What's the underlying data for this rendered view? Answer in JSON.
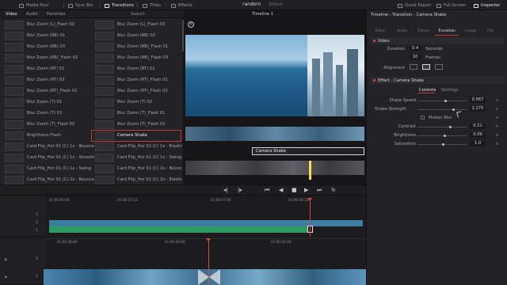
{
  "toolbar": {
    "media_pool": "Media Pool",
    "sync_bin": "Sync Bin",
    "transitions": "Transitions",
    "titles": "Titles",
    "effects": "Effects",
    "project_title": "random",
    "project_status": "Edited",
    "quick_export": "Quick Export",
    "full_screen": "Full Screen",
    "inspector": "Inspector"
  },
  "library": {
    "tabs": [
      "Video",
      "Audio",
      "Favorites"
    ],
    "search": "Search",
    "left_items": [
      "Blur Zoom (L)_Flash 02",
      "Blur Zoom (RB) 01",
      "Blur Zoom (RB) 03",
      "Blur Zoom (RB)_Flash 02",
      "Blur Zoom (RT) 01",
      "Blur Zoom (RT) 03",
      "Blur Zoom (RT)_Flash 02",
      "Blur Zoom (T) 01",
      "Blur Zoom (T) 03",
      "Blur Zoom (T)_Flash 02",
      "Brightness Flash",
      "Card Flip_Hor 01 (C) 1x - Bounce",
      "Card Flip_Hor 01 (C) 1x - Smooth",
      "Card Flip_Hor 01 (C) 1x - Swing",
      "Card Flip_Hor 01 (C) 2x - Bounce"
    ],
    "right_items": [
      "Blur Zoom (L)_Flash 03",
      "Blur Zoom (RB) 02",
      "Blur Zoom (RB)_Flash 01",
      "Blur Zoom (RB)_Flash 03",
      "Blur Zoom (RT) 02",
      "Blur Zoom (RT)_Flash 01",
      "Blur Zoom (RT)_Flash 03",
      "Blur Zoom (T) 02",
      "Blur Zoom (T)_Flash 01",
      "Blur Zoom (T)_Flash 03",
      "Camera Shake",
      "Card Flip_Hor 01 (C) 1x - Elastic",
      "Card Flip_Hor 01 (C) 1x - Swing",
      "Card Flip_Hor 01 (C) 2x - Bounce",
      "Card Flip_Hor 01 (C) 2x - Elastic"
    ]
  },
  "viewer": {
    "title": "Timeline 1",
    "transition_label": "Camera Shake"
  },
  "inspector": {
    "title": "Timeline - Transition - Camera Shake",
    "tabs": [
      "Video",
      "Audio",
      "Effects",
      "Transition",
      "Image",
      "File"
    ],
    "video_section": "Video",
    "duration_label": "Duration",
    "duration_value": "0.4",
    "duration_unit": "Seconds",
    "frames_value": "10",
    "frames_unit": "Frames",
    "alignment_label": "Alignment",
    "effect_section": "Effect - Camera Shake",
    "subtab_controls": "Controls",
    "subtab_settings": "Settings",
    "shake_speed_label": "Shake Speed",
    "shake_speed_value": "0.567",
    "shake_strength_label": "Shake Strength",
    "shake_strength_value": "2.275",
    "motion_blur_label": "Motion Blur",
    "contrast_label": "Contrast",
    "contrast_value": "0.21",
    "brightness_label": "Brightness",
    "brightness_value": "0.06",
    "saturation_label": "Saturation",
    "saturation_value": "1.0"
  },
  "timeline": {
    "ruler_top": [
      "01:00:00:00",
      "01:00:13:12",
      "01:00:27:00",
      "01:00:40:12"
    ],
    "ruler_bottom": [
      "01:00:38:00",
      "01:00:40:00",
      "01:00:42:00"
    ],
    "track_numbers": [
      "3",
      "2",
      "1",
      "2",
      "1"
    ]
  }
}
